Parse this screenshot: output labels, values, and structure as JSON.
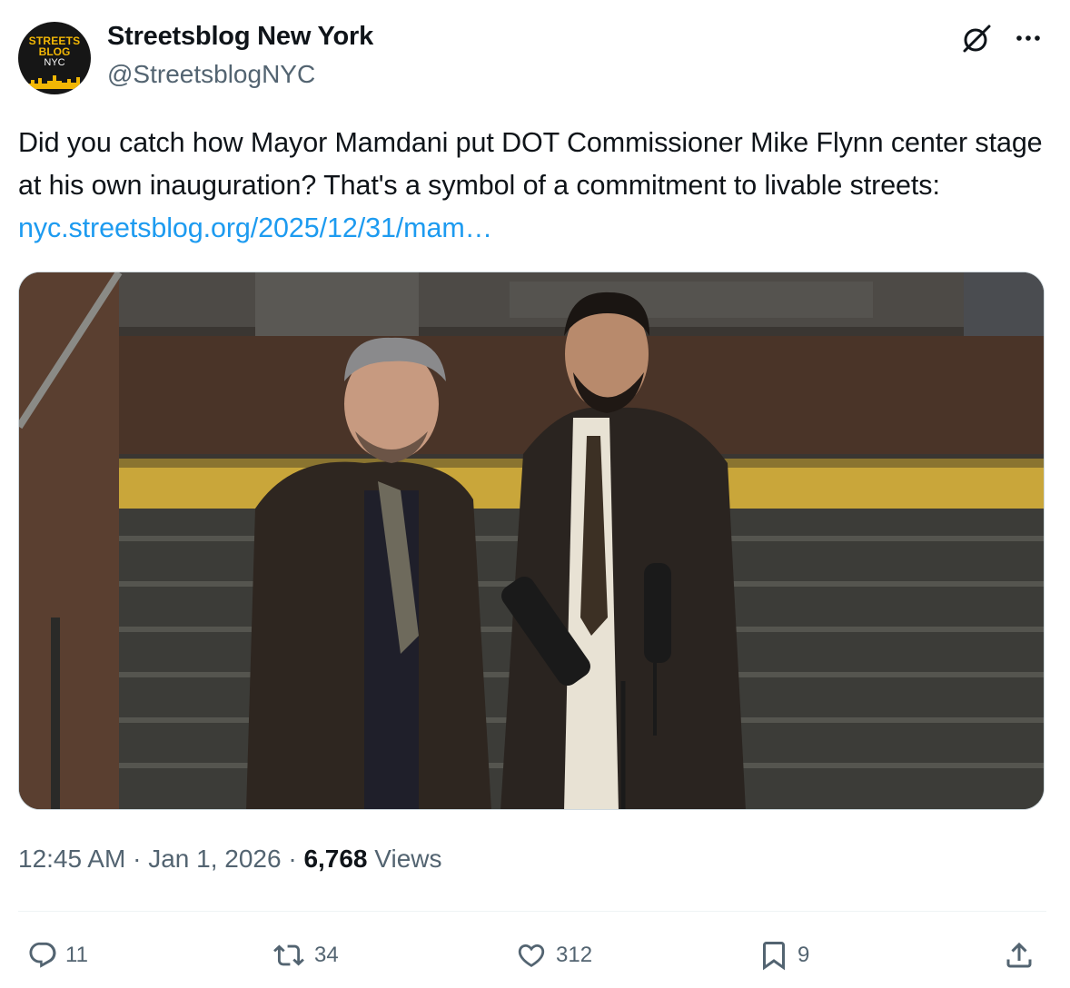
{
  "account": {
    "display_name": "Streetsblog New York",
    "handle": "@StreetsblogNYC",
    "avatar_lines": [
      "STREETS",
      "BLOG",
      "NYC"
    ]
  },
  "tweet": {
    "text": "Did you catch how Mayor Mamdani put DOT Commissioner Mike Flynn center stage at his own inauguration? That's a symbol of a commitment to livable streets: ",
    "link": "nyc.streetsblog.org/2025/12/31/mam…",
    "time": "12:45 AM",
    "date": "Jan 1, 2026",
    "views_count": "6,768",
    "views_label": "Views"
  },
  "actions": {
    "replies": "11",
    "reposts": "34",
    "likes": "312",
    "bookmarks": "9"
  },
  "icons": {
    "header": [
      "grok-icon",
      "more-icon"
    ],
    "actions": [
      "reply-icon",
      "repost-icon",
      "like-icon",
      "bookmark-icon",
      "share-icon"
    ]
  },
  "colors": {
    "link": "#1d9bf0",
    "secondary_text": "#536471",
    "avatar_accent": "#f2b705"
  }
}
